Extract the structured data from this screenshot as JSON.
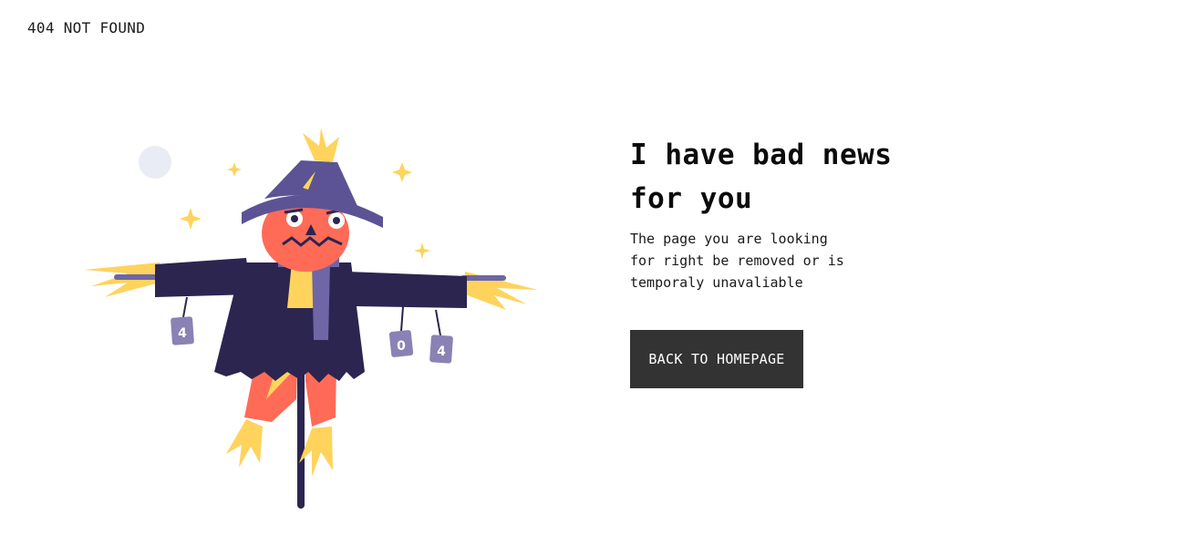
{
  "page": {
    "status_label": "404 NOT FOUND"
  },
  "main": {
    "headline_line1": "I have bad news",
    "headline_line2": "for you",
    "message_line1": "The page you are looking",
    "message_line2": "for right be removed or is",
    "message_line3": "temporaly unavaliable",
    "back_button_label": "BACK TO HOMEPAGE"
  },
  "illustration": {
    "can_labels": [
      "4",
      "0",
      "4"
    ],
    "colors": {
      "hat": "#5c5394",
      "coat": "#2b2550",
      "face": "#ff6b57",
      "straw": "#ffd35c",
      "scarf": "#6e66a6",
      "can": "#8a82b4",
      "moon": "#e9ecf5",
      "button_bg": "#333333"
    }
  }
}
